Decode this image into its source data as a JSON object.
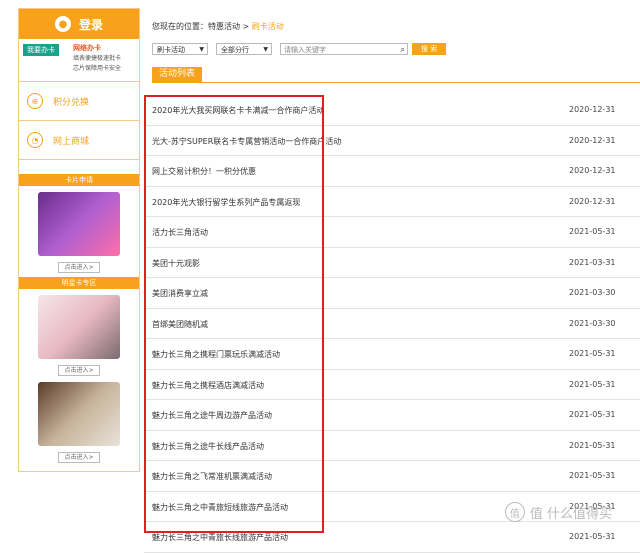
{
  "sidebar": {
    "login_label": "登录",
    "apply": {
      "tag": "我要办卡",
      "title": "网络办卡",
      "line1": "填表便捷极速批卡",
      "line2": "芯片保障用卡安全"
    },
    "nav": [
      {
        "label": "积分兑换",
        "icon": "points-icon"
      },
      {
        "label": "网上商城",
        "icon": "signal-icon"
      }
    ],
    "card_section": {
      "title": "卡片申请",
      "enter": "点击进入>"
    },
    "star_section": {
      "title": "明星卡专区",
      "enter1": "点击进入>",
      "enter2": "点击进入>"
    }
  },
  "breadcrumb": {
    "prefix": "您现在的位置：",
    "parent": "特惠活动",
    "sep": ">",
    "current": "刷卡活动"
  },
  "filters": {
    "type": "刷卡活动",
    "branch": "全部分行",
    "search_placeholder": "请输入关键字",
    "search_button": "搜 索"
  },
  "tab_label": "活动列表",
  "activities": [
    {
      "title": "2020年光大我买网联名卡卡满减一合作商户活动",
      "date": "2020-12-31"
    },
    {
      "title": "光大-苏宁SUPER联名卡专属营销活动一合作商户活动",
      "date": "2020-12-31"
    },
    {
      "title": "网上交易计积分！一积分优惠",
      "date": "2020-12-31"
    },
    {
      "title": "2020年光大银行留学生系列产品专属返现",
      "date": "2020-12-31"
    },
    {
      "title": "活力长三角活动",
      "date": "2021-05-31"
    },
    {
      "title": "美团十元观影",
      "date": "2021-03-31"
    },
    {
      "title": "美团消费享立减",
      "date": "2021-03-30"
    },
    {
      "title": "首绑美团随机减",
      "date": "2021-03-30"
    },
    {
      "title": "魅力长三角之携程门票玩乐满减活动",
      "date": "2021-05-31"
    },
    {
      "title": "魅力长三角之携程酒店满减活动",
      "date": "2021-05-31"
    },
    {
      "title": "魅力长三角之途牛周边游产品活动",
      "date": "2021-05-31"
    },
    {
      "title": "魅力长三角之途牛长线产品活动",
      "date": "2021-05-31"
    },
    {
      "title": "魅力长三角之飞常准机票满减活动",
      "date": "2021-05-31"
    },
    {
      "title": "魅力长三角之中青旅短线旅游产品活动",
      "date": "2021-05-31"
    },
    {
      "title": "魅力长三角之中青旅长线旅游产品活动",
      "date": "2021-05-31"
    }
  ],
  "watermark": "值 什么值得买",
  "colors": {
    "accent": "#f7a21a",
    "highlight_box": "#e02020",
    "tag_green": "#1aa38a"
  }
}
